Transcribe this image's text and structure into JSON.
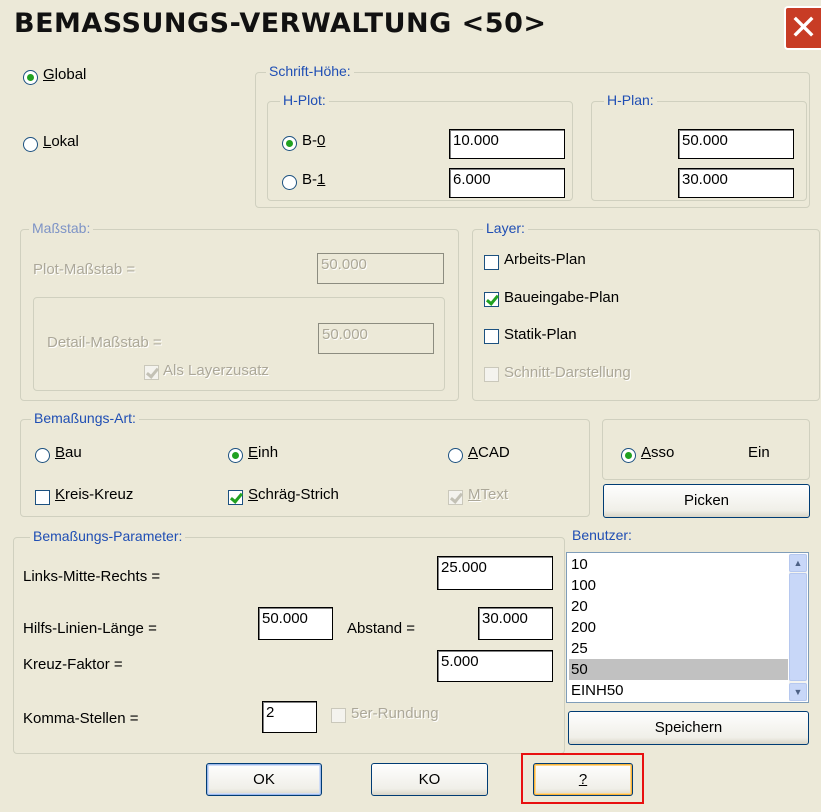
{
  "window": {
    "title": "BEMASSUNGS-VERWALTUNG <50>",
    "close_glyph": "✕"
  },
  "scope": {
    "global_label": "Global",
    "global_key": "G",
    "lokal_label": "Lokal",
    "lokal_key": "L",
    "selected": "Global"
  },
  "schrift_hoehe": {
    "legend": "Schrift-Höhe:",
    "h_plot": {
      "legend": "H-Plot:",
      "b0_label": "B-",
      "b0_key": "0",
      "b1_label": "B-",
      "b1_key": "1",
      "b0_value": "10.000",
      "b1_value": "6.000",
      "selected": "B-0"
    },
    "h_plan": {
      "legend": "H-Plan:",
      "b0_value": "50.000",
      "b1_value": "30.000"
    }
  },
  "massstab": {
    "legend": "Maßstab:",
    "plot_label": "Plot-Maßstab =",
    "plot_value": "50.000",
    "detail_label": "Detail-Maßstab =",
    "detail_value": "50.000",
    "layerzusatz_label": "Als Layerzusatz",
    "layerzusatz_checked": true
  },
  "layer": {
    "legend": "Layer:",
    "items": [
      {
        "label": "Arbeits-Plan",
        "checked": false,
        "enabled": true
      },
      {
        "label": "Baueingabe-Plan",
        "checked": true,
        "enabled": true
      },
      {
        "label": "Statik-Plan",
        "checked": false,
        "enabled": true
      },
      {
        "label": "Schnitt-Darstellung",
        "checked": false,
        "enabled": false
      }
    ]
  },
  "bemassungs_art": {
    "legend": "Bemaßungs-Art:",
    "bau_label": "Bau",
    "bau_key": "B",
    "einh_label": "Einh",
    "einh_key": "E",
    "acad_label": "ACAD",
    "acad_key": "A",
    "selected": "Einh",
    "kreis_kreuz_label": "Kreis-Kreuz",
    "kreis_kreuz_key": "K",
    "kreis_kreuz_checked": false,
    "schraeg_strich_label": "Schräg-Strich",
    "schraeg_strich_key": "S",
    "schraeg_strich_checked": true,
    "mtext_label": "MText",
    "mtext_key": "M",
    "mtext_checked": true
  },
  "asso": {
    "label": "Asso",
    "key": "A",
    "selected": true,
    "status": "Ein",
    "picken_label": "Picken"
  },
  "parameter": {
    "legend": "Bemaßungs-Parameter:",
    "lmr_label": "Links-Mitte-Rechts =",
    "lmr_value": "25.000",
    "hilfs_label": "Hilfs-Linien-Länge =",
    "hilfs_value": "50.000",
    "abstand_label": "Abstand =",
    "abstand_value": "30.000",
    "kreuz_label": "Kreuz-Faktor =",
    "kreuz_value": "5.000",
    "komma_label": "Komma-Stellen =",
    "komma_value": "2",
    "rundung_label": "5er-Rundung",
    "rundung_checked": false
  },
  "benutzer": {
    "legend": "Benutzer:",
    "items": [
      "10",
      "100",
      "20",
      "200",
      "25",
      "50",
      "EINH50"
    ],
    "selected": "50",
    "speichern_label": "Speichern"
  },
  "footer": {
    "ok_label": "OK",
    "ko_label": "KO",
    "help_label": "?"
  },
  "colors": {
    "legend_text": "#1f4eb4",
    "dialog_bg": "#ece9d8",
    "radio_dot": "#21a121",
    "highlight_box": "#e81010",
    "close_button": "#c83c25"
  }
}
